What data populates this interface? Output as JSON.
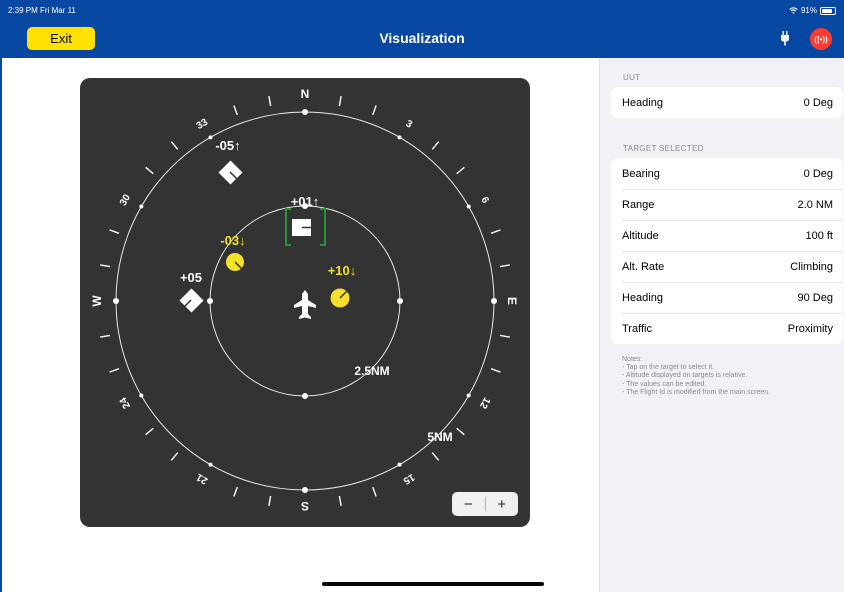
{
  "status": {
    "time": "2:39 PM  Fri Mar 11",
    "battery": "91%"
  },
  "nav": {
    "exit_label": "Exit",
    "title": "Visualization"
  },
  "radar": {
    "cardinals": {
      "n": "N",
      "e": "E",
      "s": "S",
      "w": "W"
    },
    "bearing_labels": [
      "3",
      "6",
      "12",
      "15",
      "21",
      "24",
      "30",
      "33"
    ],
    "ring_labels": {
      "inner": "2.5NM",
      "outer": "5NM"
    },
    "zoom": {
      "minus": "−",
      "plus": "+"
    },
    "targets": [
      {
        "alt": "-05↑",
        "type": "proximity-diamond",
        "color": "#ffffff"
      },
      {
        "alt": "+01↑",
        "type": "selected-square",
        "color": "#ffffff"
      },
      {
        "alt": "-03↓",
        "type": "traffic-circle",
        "color": "#f5e02a"
      },
      {
        "alt": "+10↓",
        "type": "traffic-circle",
        "color": "#f5e02a"
      },
      {
        "alt": "+05",
        "type": "proximity-diamond",
        "color": "#ffffff"
      }
    ],
    "colors": {
      "background": "#333333",
      "ring": "#ffffff",
      "traffic": "#f5e02a",
      "selected_bracket": "#2f8f3a"
    }
  },
  "uut": {
    "header": "UUT",
    "rows": [
      {
        "label": "Heading",
        "value": "0 Deg"
      }
    ]
  },
  "target": {
    "header": "TARGET SELECTED",
    "rows": [
      {
        "label": "Bearing",
        "value": "0 Deg"
      },
      {
        "label": "Range",
        "value": "2.0 NM"
      },
      {
        "label": "Altitude",
        "value": "100 ft"
      },
      {
        "label": "Alt. Rate",
        "value": "Climbing"
      },
      {
        "label": "Heading",
        "value": "90 Deg"
      },
      {
        "label": "Traffic",
        "value": "Proximity"
      }
    ]
  },
  "notes": {
    "title": "Notes:",
    "lines": [
      "- Tap on the target to select it.",
      "- Altitude displayed on targets is relative.",
      "- The values can be edited.",
      "- The Flight Id is modified from the main screen."
    ]
  },
  "theme": {
    "nav_blue": "#0748a3",
    "exit_yellow": "#ffe000",
    "alert_red": "#ff3b30"
  }
}
